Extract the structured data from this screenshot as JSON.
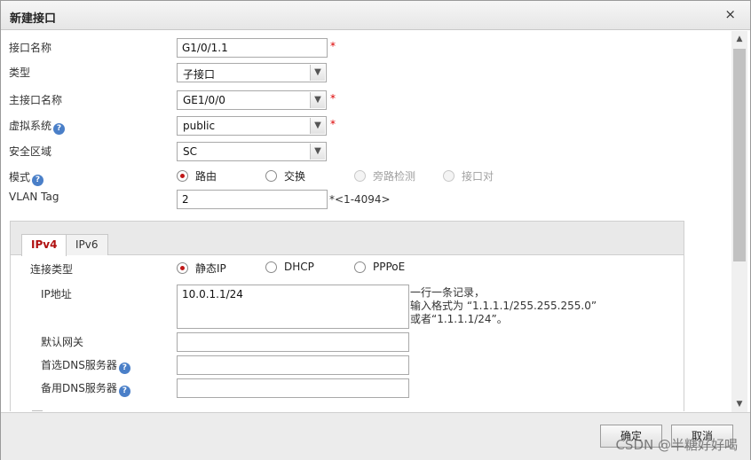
{
  "dialog": {
    "title": "新建接口",
    "close_label": "×"
  },
  "form": {
    "interface_name": {
      "label": "接口名称",
      "value": "G1/0/1.1",
      "required": "*"
    },
    "type": {
      "label": "类型",
      "value": "子接口"
    },
    "main_interface": {
      "label": "主接口名称",
      "value": "GE1/0/0",
      "required": "*"
    },
    "virtual_system": {
      "label": "虚拟系统",
      "value": "public",
      "required": "*",
      "help": "?"
    },
    "security_zone": {
      "label": "安全区域",
      "value": "SC"
    },
    "mode": {
      "label": "模式",
      "help": "?",
      "options": [
        {
          "label": "路由",
          "selected": true,
          "disabled": false
        },
        {
          "label": "交换",
          "selected": false,
          "disabled": false
        },
        {
          "label": "旁路检测",
          "selected": false,
          "disabled": true
        },
        {
          "label": "接口对",
          "selected": false,
          "disabled": true
        }
      ]
    },
    "vlan_tag": {
      "label": "VLAN Tag",
      "value": "2",
      "hint": "*<1-4094>"
    }
  },
  "tabs": [
    {
      "label": "IPv4",
      "active": true
    },
    {
      "label": "IPv6",
      "active": false
    }
  ],
  "ipv4": {
    "connection_type": {
      "label": "连接类型",
      "options": [
        {
          "label": "静态IP",
          "selected": true
        },
        {
          "label": "DHCP",
          "selected": false
        },
        {
          "label": "PPPoE",
          "selected": false
        }
      ]
    },
    "ip_address": {
      "label": "IP地址",
      "value": "10.0.1.1/24",
      "hint_lines": [
        "一行一条记录，",
        "输入格式为 “1.1.1.1/255.255.255.0”",
        "或者“1.1.1.1/24”。"
      ]
    },
    "default_gateway": {
      "label": "默认网关",
      "value": ""
    },
    "primary_dns": {
      "label": "首选DNS服务器",
      "value": "",
      "help": "?"
    },
    "secondary_dns": {
      "label": "备用DNS服务器",
      "value": "",
      "help": "?"
    }
  },
  "footer": {
    "ok_label": "确定",
    "cancel_label": "取消"
  },
  "watermark": "CSDN @半糖好好喝",
  "icons": {
    "dropdown": "chevron-down-icon",
    "help": "help-icon",
    "close": "close-icon",
    "scroll_up": "arrow-up-icon",
    "scroll_down": "arrow-down-icon"
  },
  "colors": {
    "accent_red": "#c01818",
    "help_blue": "#4a7fc8",
    "footer_bg": "#ececec"
  }
}
